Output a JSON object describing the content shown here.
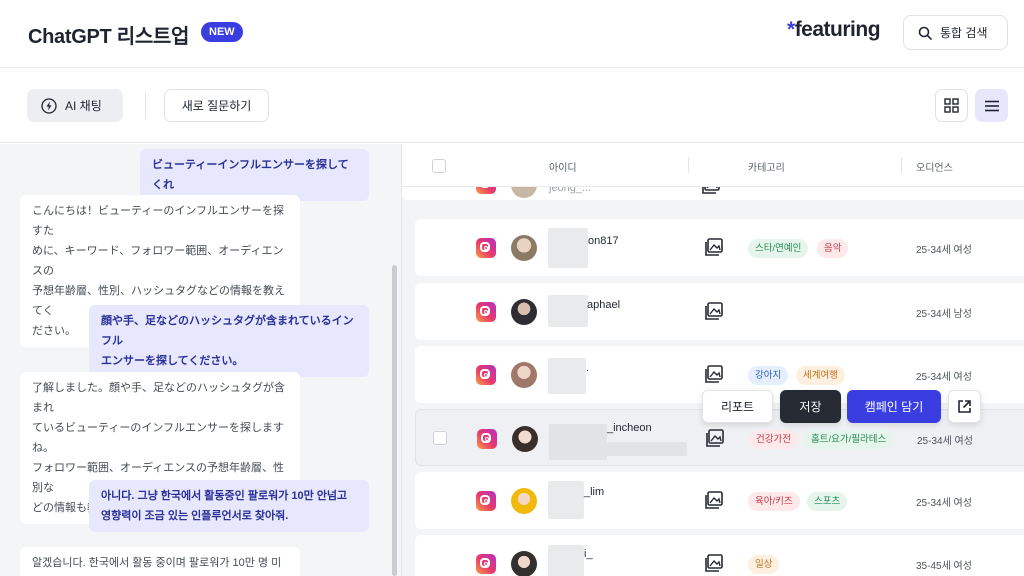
{
  "header": {
    "title": "ChatGPT 리스트업",
    "badge": "NEW",
    "logo_star": "*",
    "logo_text": "featuring",
    "search_label": "통합 검색"
  },
  "toolbar": {
    "ai_chat_label": "AI 채팅",
    "new_question_label": "새로 질문하기"
  },
  "chat": {
    "messages": [
      {
        "role": "user",
        "lines": [
          "ビューティーインフルエンサーを探してくれ"
        ]
      },
      {
        "role": "bot",
        "lines": [
          "こんにちは！ビューティーのインフルエンサーを探すた",
          "めに、キーワード、フォロワー範囲、オーディエンスの",
          "予想年齢層、性別、ハッシュタグなどの情報を教えてく",
          "ださい。"
        ]
      },
      {
        "role": "user",
        "lines": [
          "顔や手、足などのハッシュタグが含まれているインフル",
          "エンサーを探してください。"
        ]
      },
      {
        "role": "bot",
        "lines": [
          "了解しました。顔や手、足などのハッシュタグが含まれ",
          "ているビューティーのインフルエンサーを探しますね。",
          "フォロワー範囲、オーディエンスの予想年齢層、性別な",
          "どの情報も教えていただけますか？"
        ]
      },
      {
        "role": "user",
        "lines": [
          "아니다. 그냥 한국에서 활동중인 팔로워가 10만 안넘고",
          "영향력이 조금 있는 인플루언서로 찾아줘."
        ]
      },
      {
        "role": "bot",
        "lines": [
          "알겠습니다. 한국에서 활동 중이며 팔로워가 10만 명 미"
        ]
      }
    ]
  },
  "table": {
    "columns": [
      "아이디",
      "카테고리",
      "오디언스"
    ],
    "rows": [
      {
        "handle": "jeong_...",
        "tags": [],
        "audience": ""
      },
      {
        "handle": "on817",
        "tags": [
          {
            "text": "스타/연예인",
            "color": "green"
          },
          {
            "text": "음악",
            "color": "red"
          }
        ],
        "audience": "25-34세 여성"
      },
      {
        "handle": "aphael",
        "tags": [],
        "audience": "25-34세 남성"
      },
      {
        "handle": ".",
        "tags": [
          {
            "text": "강아지",
            "color": "blue"
          },
          {
            "text": "세계여행",
            "color": "orange"
          }
        ],
        "audience": "25-34세 여성"
      },
      {
        "handle": "_incheon",
        "tags": [
          {
            "text": "건강가전",
            "color": "red"
          },
          {
            "text": "홈트/요가/필라테스",
            "color": "green"
          }
        ],
        "audience": "25-34세 여성"
      },
      {
        "handle": "_lim",
        "tags": [
          {
            "text": "육아/키즈",
            "color": "red"
          },
          {
            "text": "스포츠",
            "color": "green"
          }
        ],
        "audience": "25-34세 여성"
      },
      {
        "handle": "i_",
        "tags": [
          {
            "text": "일상",
            "color": "orange"
          }
        ],
        "audience": "35-45세 여성"
      }
    ],
    "actions": {
      "report": "리포트",
      "save": "저장",
      "campaign": "캠페인 담기"
    }
  },
  "colors": {
    "accent": "#3a3ee0",
    "user_bubble": "#e7e8fd",
    "dark_button": "#262a33"
  }
}
